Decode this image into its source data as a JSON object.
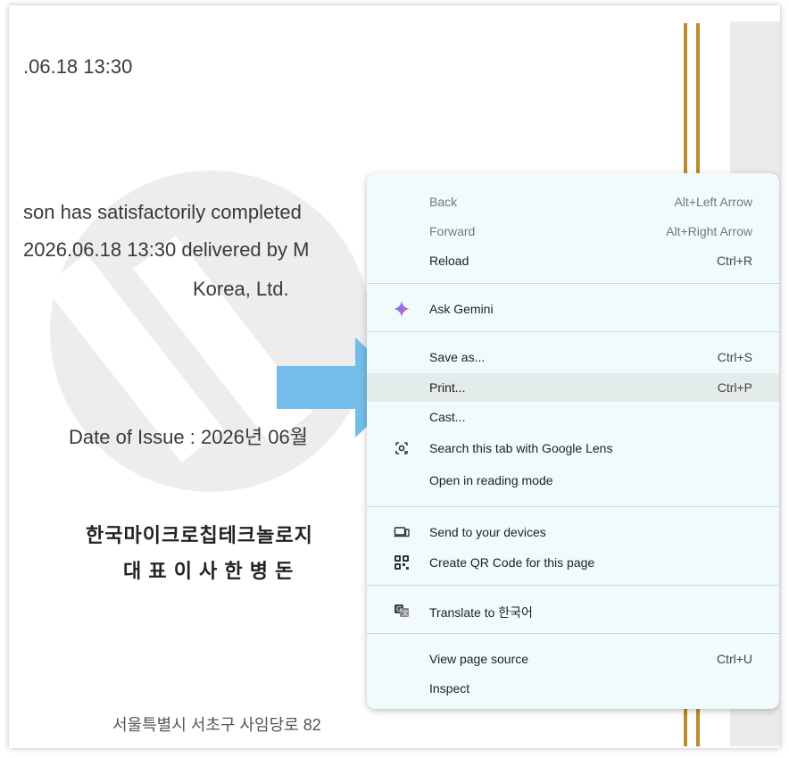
{
  "certificate": {
    "date_fragment": ".06.18 13:30",
    "line1": "son has satisfactorily completed",
    "line2": "2026.06.18 13:30 delivered by M",
    "line3": "Korea, Ltd.",
    "issue": "Date of Issue : 2026년 06월",
    "company": "한국마이크로칩테크놀로지",
    "ceo": "대 표 이 사   한 병 돈",
    "address": "서울특별시 서초구 사임당로 82"
  },
  "menu": {
    "back": {
      "label": "Back",
      "shortcut": "Alt+Left Arrow"
    },
    "forward": {
      "label": "Forward",
      "shortcut": "Alt+Right Arrow"
    },
    "reload": {
      "label": "Reload",
      "shortcut": "Ctrl+R"
    },
    "ask_gemini": {
      "label": "Ask Gemini"
    },
    "save_as": {
      "label": "Save as...",
      "shortcut": "Ctrl+S"
    },
    "print": {
      "label": "Print...",
      "shortcut": "Ctrl+P"
    },
    "cast": {
      "label": "Cast..."
    },
    "lens": {
      "label": "Search this tab with Google Lens"
    },
    "reading_mode": {
      "label": "Open in reading mode"
    },
    "send_devices": {
      "label": "Send to your devices"
    },
    "qr_code": {
      "label": "Create QR Code for this page"
    },
    "translate": {
      "label": "Translate to 한국어"
    },
    "view_source": {
      "label": "View page source",
      "shortcut": "Ctrl+U"
    },
    "inspect": {
      "label": "Inspect"
    }
  },
  "colors": {
    "arrow": "#74bde9",
    "gold": "#b98a2e",
    "menu_bg": "#f2fbfb",
    "menu_separator": "#b9e3e3",
    "hover_bg": "#e3ebeb"
  },
  "icons": [
    "gemini-sparkle-icon",
    "google-lens-icon",
    "send-devices-icon",
    "qr-code-icon",
    "translate-icon"
  ]
}
